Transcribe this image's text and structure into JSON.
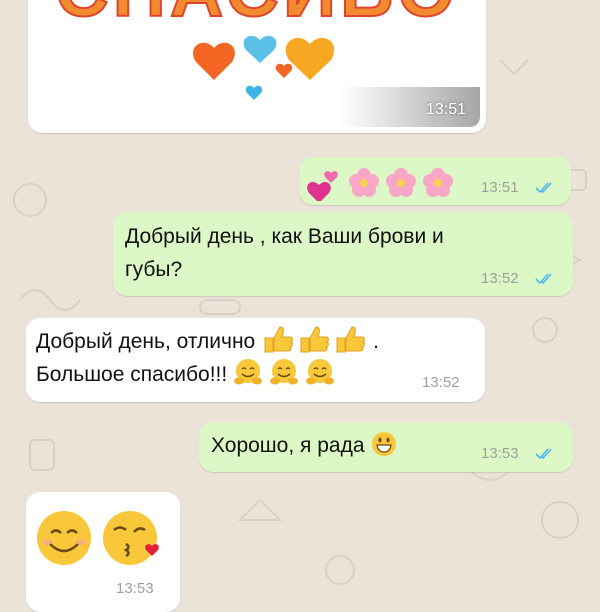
{
  "chat": {
    "image_message": {
      "caption": "СПАСИБО",
      "time": "13:51"
    },
    "messages": [
      {
        "dir": "out",
        "kind": "emoji",
        "text": "💕🌸🌸🌸",
        "time": "13:51",
        "status": "read"
      },
      {
        "dir": "out",
        "kind": "text",
        "line1": "Добрый день , как Ваши брови и",
        "line2": "губы?",
        "time": "13:52",
        "status": "read"
      },
      {
        "dir": "in",
        "kind": "text",
        "line1": "Добрый день, отлично",
        "line1_emoji": "👍👍👍",
        "line1_end": ".",
        "line2": "Большое спасибо!!!",
        "line2_emoji": "🤗🤗🤗",
        "time": "13:52"
      },
      {
        "dir": "out",
        "kind": "text",
        "text": "Хорошо, я рада",
        "emoji": "😀",
        "time": "13:53",
        "status": "read"
      },
      {
        "dir": "in",
        "kind": "emoji",
        "text": "😊😘",
        "time": "13:53"
      }
    ]
  },
  "colors": {
    "background": "#ebe3d8",
    "outgoing_bubble": "#dcf8c6",
    "incoming_bubble": "#ffffff",
    "read_ticks": "#4fb6ec"
  }
}
